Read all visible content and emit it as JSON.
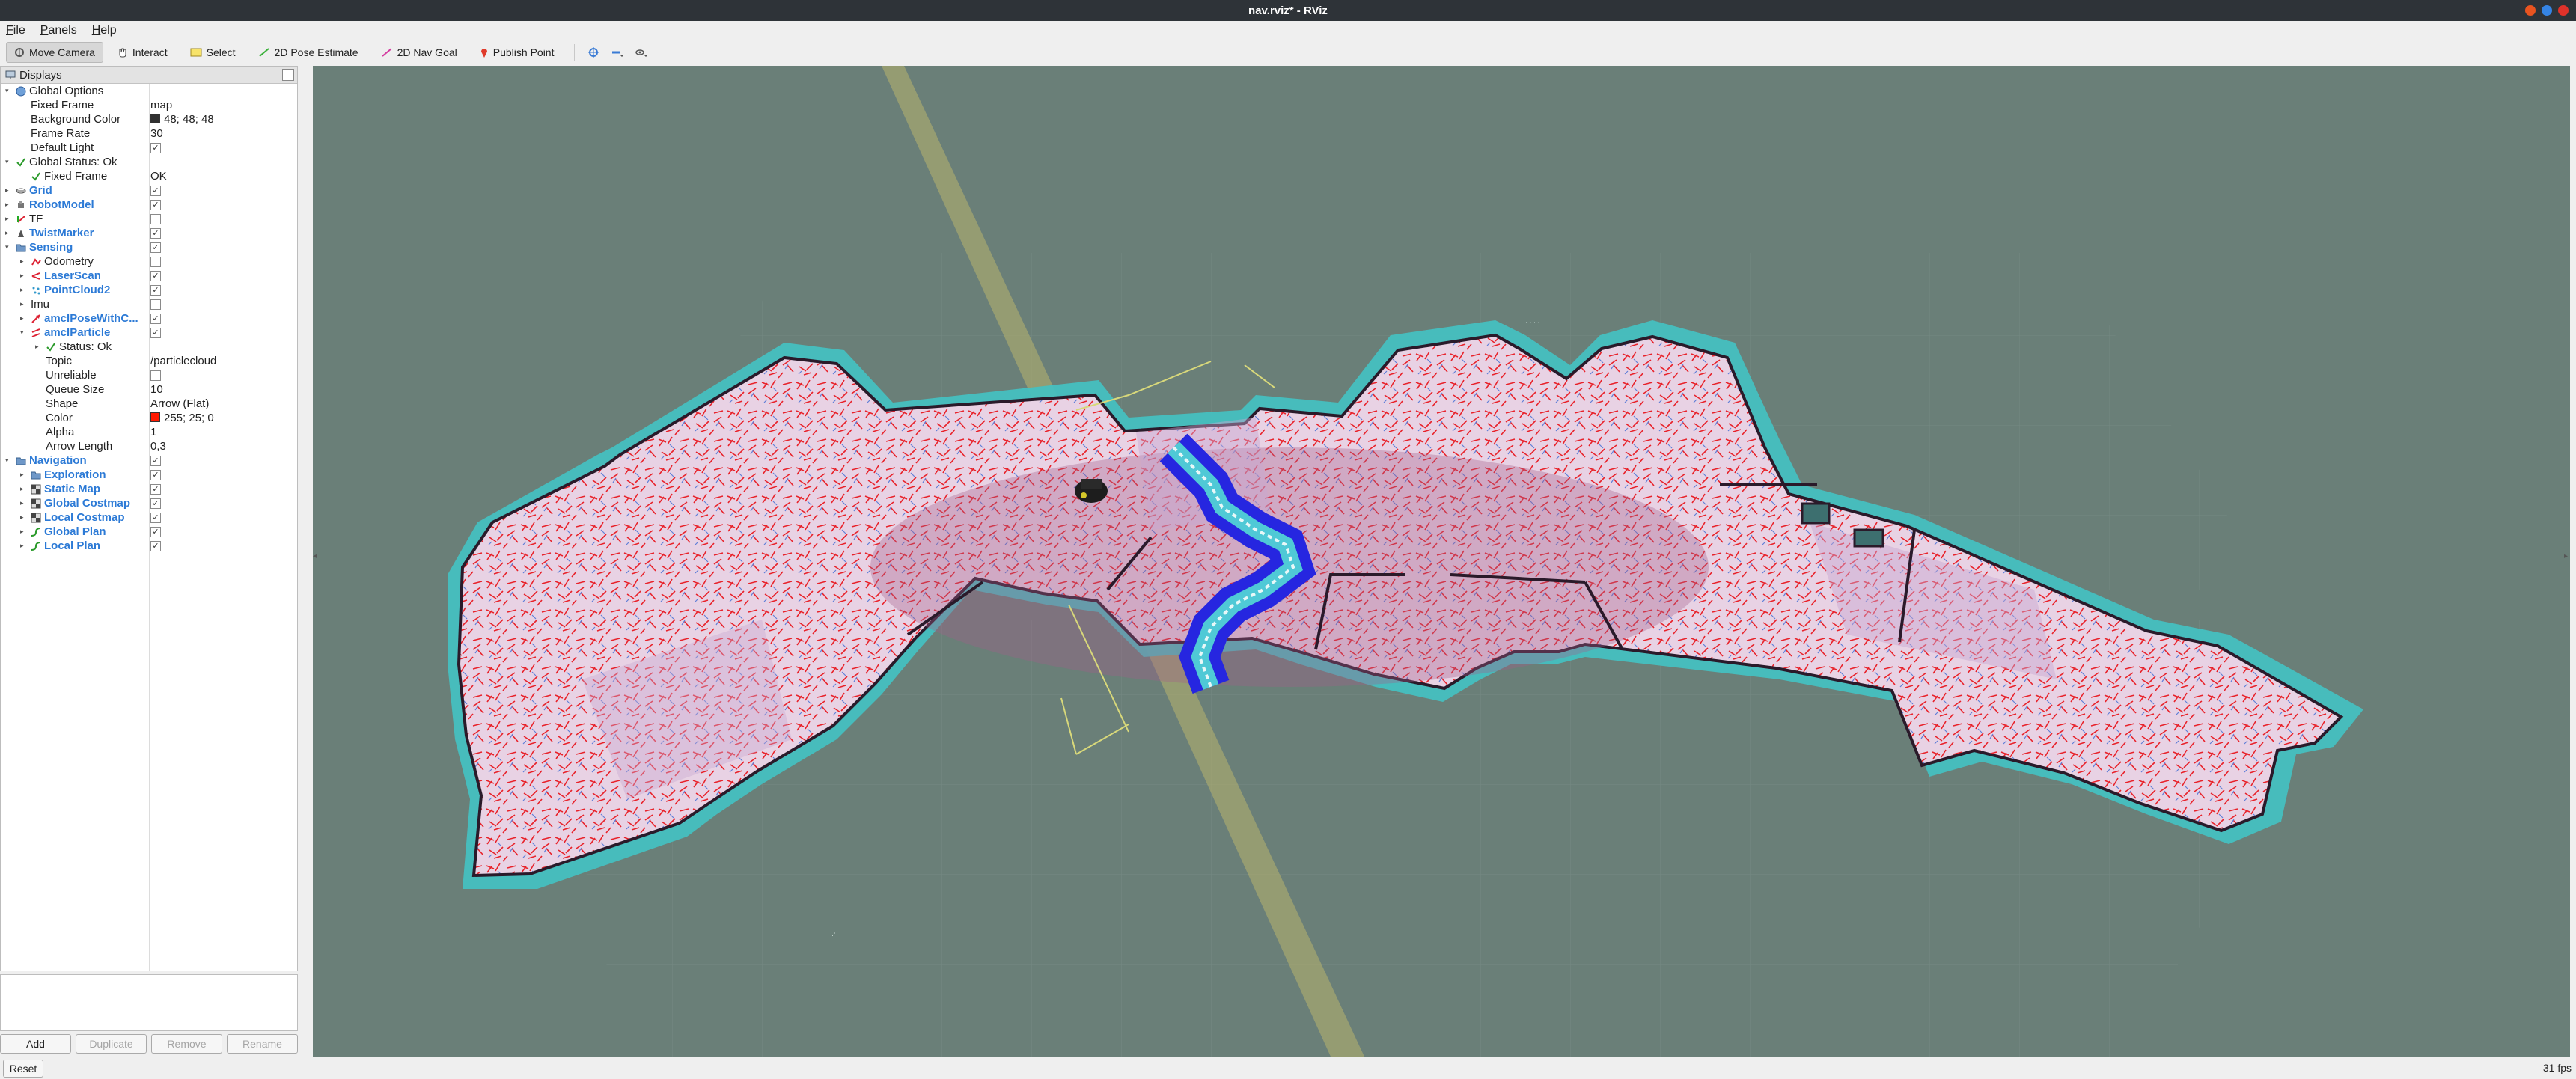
{
  "window": {
    "title": "nav.rviz* - RViz"
  },
  "menu": [
    {
      "underline": "F",
      "rest": "ile"
    },
    {
      "underline": "P",
      "rest": "anels"
    },
    {
      "underline": "H",
      "rest": "elp"
    }
  ],
  "toolbar": {
    "move_camera": "Move Camera",
    "interact": "Interact",
    "select": "Select",
    "pose_estimate": "2D Pose Estimate",
    "nav_goal": "2D Nav Goal",
    "publish_point": "Publish Point"
  },
  "displays": {
    "title": "Displays",
    "rows": [
      {
        "key": "global-options",
        "depth": 0,
        "arrow": "open",
        "icon": "globe-icon",
        "label": "Global Options",
        "style": "normal"
      },
      {
        "key": "fixed-frame",
        "depth": 1,
        "arrow": "none",
        "icon": "",
        "label": "Fixed Frame",
        "value": "map",
        "style": "normal"
      },
      {
        "key": "background-color",
        "depth": 1,
        "arrow": "none",
        "icon": "",
        "label": "Background Color",
        "value": "48; 48; 48",
        "swatch": "#303030",
        "style": "normal"
      },
      {
        "key": "frame-rate",
        "depth": 1,
        "arrow": "none",
        "icon": "",
        "label": "Frame Rate",
        "value": "30",
        "style": "normal"
      },
      {
        "key": "default-light",
        "depth": 1,
        "arrow": "none",
        "icon": "",
        "label": "Default Light",
        "check": true,
        "style": "normal"
      },
      {
        "key": "global-status",
        "depth": 0,
        "arrow": "open",
        "icon": "check-icon",
        "label": "Global Status: Ok",
        "style": "normal"
      },
      {
        "key": "status-fixed-frame",
        "depth": 1,
        "arrow": "none",
        "icon": "check-icon",
        "label": "Fixed Frame",
        "value": "OK",
        "style": "normal"
      },
      {
        "key": "grid",
        "depth": 0,
        "arrow": "closed",
        "icon": "grid-icon",
        "label": "Grid",
        "check": true,
        "style": "plugin"
      },
      {
        "key": "robot-model",
        "depth": 0,
        "arrow": "closed",
        "icon": "robot-icon",
        "label": "RobotModel",
        "check": true,
        "style": "plugin"
      },
      {
        "key": "tf",
        "depth": 0,
        "arrow": "closed",
        "icon": "tf-icon",
        "label": "TF",
        "check": false,
        "style": "normal"
      },
      {
        "key": "twist-marker",
        "depth": 0,
        "arrow": "closed",
        "icon": "marker-icon",
        "label": "TwistMarker",
        "check": true,
        "style": "plugin"
      },
      {
        "key": "sensing",
        "depth": 0,
        "arrow": "open",
        "icon": "folder-icon",
        "label": "Sensing",
        "check": true,
        "style": "plugin"
      },
      {
        "key": "odometry",
        "depth": 1,
        "arrow": "closed",
        "icon": "odometry-icon",
        "label": "Odometry",
        "check": false,
        "style": "normal"
      },
      {
        "key": "laser-scan",
        "depth": 1,
        "arrow": "closed",
        "icon": "laser-icon",
        "label": "LaserScan",
        "check": true,
        "style": "plugin"
      },
      {
        "key": "point-cloud2",
        "depth": 1,
        "arrow": "closed",
        "icon": "pointcloud-icon",
        "label": "PointCloud2",
        "check": true,
        "style": "plugin"
      },
      {
        "key": "imu",
        "depth": 1,
        "arrow": "closed",
        "icon": "",
        "label": "Imu",
        "check": false,
        "style": "normal"
      },
      {
        "key": "amcl-pose",
        "depth": 1,
        "arrow": "closed",
        "icon": "pose-icon",
        "label": "amclPoseWithC...",
        "check": true,
        "style": "plugin"
      },
      {
        "key": "amcl-particle",
        "depth": 1,
        "arrow": "open",
        "icon": "pose-array-icon",
        "label": "amclParticle",
        "check": true,
        "style": "plugin"
      },
      {
        "key": "particle-status",
        "depth": 2,
        "arrow": "closed",
        "icon": "check-icon",
        "label": "Status: Ok",
        "style": "normal"
      },
      {
        "key": "particle-topic",
        "depth": 2,
        "arrow": "none",
        "icon": "",
        "label": "Topic",
        "value": "/particlecloud",
        "style": "normal"
      },
      {
        "key": "particle-unreliable",
        "depth": 2,
        "arrow": "none",
        "icon": "",
        "label": "Unreliable",
        "check": false,
        "style": "normal"
      },
      {
        "key": "particle-queue-size",
        "depth": 2,
        "arrow": "none",
        "icon": "",
        "label": "Queue Size",
        "value": "10",
        "style": "normal"
      },
      {
        "key": "particle-shape",
        "depth": 2,
        "arrow": "none",
        "icon": "",
        "label": "Shape",
        "value": "Arrow (Flat)",
        "style": "normal"
      },
      {
        "key": "particle-color",
        "depth": 2,
        "arrow": "none",
        "icon": "",
        "label": "Color",
        "value": "255; 25; 0",
        "swatch": "#ff1900",
        "style": "normal"
      },
      {
        "key": "particle-alpha",
        "depth": 2,
        "arrow": "none",
        "icon": "",
        "label": "Alpha",
        "value": "1",
        "style": "normal"
      },
      {
        "key": "particle-arrow-length",
        "depth": 2,
        "arrow": "none",
        "icon": "",
        "label": "Arrow Length",
        "value": "0,3",
        "style": "normal"
      },
      {
        "key": "navigation",
        "depth": 0,
        "arrow": "open",
        "icon": "folder-icon",
        "label": "Navigation",
        "check": true,
        "style": "plugin"
      },
      {
        "key": "exploration",
        "depth": 1,
        "arrow": "closed",
        "icon": "folder-icon",
        "label": "Exploration",
        "check": true,
        "style": "plugin"
      },
      {
        "key": "static-map",
        "depth": 1,
        "arrow": "closed",
        "icon": "map-icon",
        "label": "Static Map",
        "check": true,
        "style": "plugin"
      },
      {
        "key": "global-costmap",
        "depth": 1,
        "arrow": "closed",
        "icon": "map-icon",
        "label": "Global Costmap",
        "check": true,
        "style": "plugin"
      },
      {
        "key": "local-costmap",
        "depth": 1,
        "arrow": "closed",
        "icon": "map-icon",
        "label": "Local Costmap",
        "check": true,
        "style": "plugin"
      },
      {
        "key": "global-plan",
        "depth": 1,
        "arrow": "closed",
        "icon": "path-icon",
        "label": "Global Plan",
        "check": true,
        "style": "plugin"
      },
      {
        "key": "local-plan",
        "depth": 1,
        "arrow": "closed",
        "icon": "path-icon",
        "label": "Local Plan",
        "check": true,
        "style": "plugin"
      }
    ]
  },
  "buttons": {
    "add": "Add",
    "duplicate": "Duplicate",
    "remove": "Remove",
    "rename": "Rename"
  },
  "status": {
    "reset": "Reset",
    "fps": "31 fps"
  },
  "colors": {
    "viewport_bg": "#6a7f78",
    "plugin_label": "#2c7ad6",
    "particle_red": "#ff1900",
    "costmap_cyan": "#49c8c8",
    "plan_blue": "#2a2ae6",
    "map_fill": "#e6cfe0"
  }
}
